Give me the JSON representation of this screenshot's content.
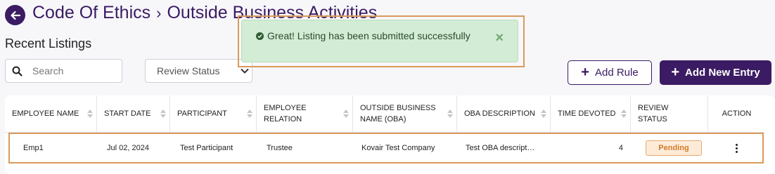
{
  "header": {
    "breadcrumb": [
      "Code Of Ethics",
      "Outside Business Activities"
    ],
    "separator": "›"
  },
  "section_title": "Recent Listings",
  "search": {
    "placeholder": "Search",
    "value": ""
  },
  "filter": {
    "label": "Review Status"
  },
  "buttons": {
    "add_rule": "Add Rule",
    "add_new_entry": "Add New Entry"
  },
  "toast": {
    "message": "Great! Listing has been submitted successfully",
    "close": "×"
  },
  "table": {
    "columns": [
      "EMPLOYEE NAME",
      "START DATE",
      "PARTICIPANT",
      "EMPLOYEE RELATION",
      "OUTSIDE BUSINESS NAME (OBA)",
      "OBA DESCRIPTION",
      "TIME DEVOTED",
      "REVIEW STATUS",
      "ACTION"
    ],
    "rows": [
      {
        "employee_name": "Emp1",
        "start_date": "Jul 02, 2024",
        "participant": "Test Participant",
        "employee_relation": "Trustee",
        "business_name": "Kovair Test Company",
        "oba_description": "Test OBA descript…",
        "time_devoted": "4",
        "review_status": "Pending"
      }
    ]
  },
  "colors": {
    "brand": "#3b1b63",
    "toast_bg": "#d3ecd5",
    "pending_bg": "#fdebd8",
    "pending_text": "#d17a2a",
    "highlight_frame": "#d99a5a"
  }
}
